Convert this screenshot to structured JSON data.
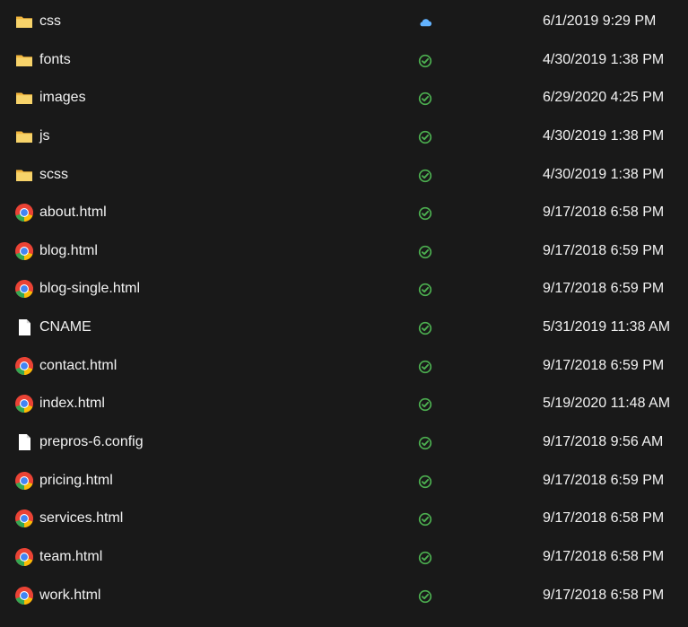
{
  "colors": {
    "background": "#191919",
    "text": "#f2f2f2",
    "folder": "#f4c84f",
    "sync_ok": "#4caf50",
    "cloud": "#63b3ff"
  },
  "files": [
    {
      "name": "css",
      "type": "folder",
      "status": "cloud",
      "modified": "6/1/2019 9:29 PM"
    },
    {
      "name": "fonts",
      "type": "folder",
      "status": "synced",
      "modified": "4/30/2019 1:38 PM"
    },
    {
      "name": "images",
      "type": "folder",
      "status": "synced",
      "modified": "6/29/2020 4:25 PM"
    },
    {
      "name": "js",
      "type": "folder",
      "status": "synced",
      "modified": "4/30/2019 1:38 PM"
    },
    {
      "name": "scss",
      "type": "folder",
      "status": "synced",
      "modified": "4/30/2019 1:38 PM"
    },
    {
      "name": "about.html",
      "type": "html",
      "status": "synced",
      "modified": "9/17/2018 6:58 PM"
    },
    {
      "name": "blog.html",
      "type": "html",
      "status": "synced",
      "modified": "9/17/2018 6:59 PM"
    },
    {
      "name": "blog-single.html",
      "type": "html",
      "status": "synced",
      "modified": "9/17/2018 6:59 PM"
    },
    {
      "name": "CNAME",
      "type": "file",
      "status": "synced",
      "modified": "5/31/2019 11:38 AM"
    },
    {
      "name": "contact.html",
      "type": "html",
      "status": "synced",
      "modified": "9/17/2018 6:59 PM"
    },
    {
      "name": "index.html",
      "type": "html",
      "status": "synced",
      "modified": "5/19/2020 11:48 AM"
    },
    {
      "name": "prepros-6.config",
      "type": "file",
      "status": "synced",
      "modified": "9/17/2018 9:56 AM"
    },
    {
      "name": "pricing.html",
      "type": "html",
      "status": "synced",
      "modified": "9/17/2018 6:59 PM"
    },
    {
      "name": "services.html",
      "type": "html",
      "status": "synced",
      "modified": "9/17/2018 6:58 PM"
    },
    {
      "name": "team.html",
      "type": "html",
      "status": "synced",
      "modified": "9/17/2018 6:58 PM"
    },
    {
      "name": "work.html",
      "type": "html",
      "status": "synced",
      "modified": "9/17/2018 6:58 PM"
    }
  ]
}
